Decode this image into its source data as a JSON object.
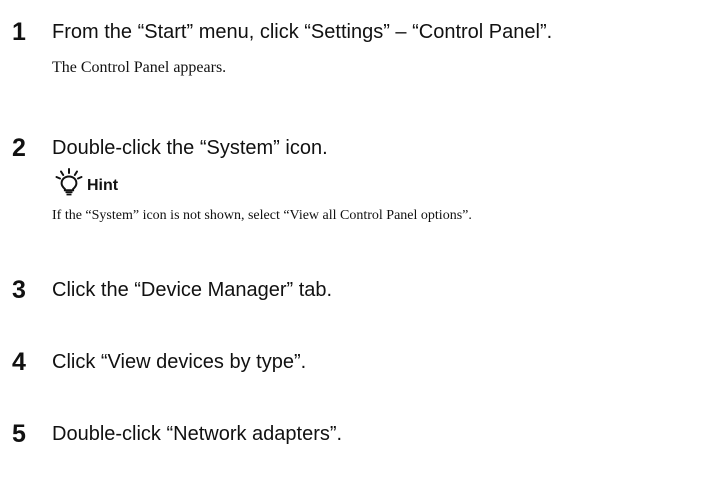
{
  "steps": [
    {
      "number": "1",
      "instruction": "From the “Start” menu, click “Settings” – “Control Panel”.",
      "result": "The Control Panel appears."
    },
    {
      "number": "2",
      "instruction": "Double-click the “System” icon.",
      "hint": {
        "label": "Hint",
        "icon": "lightbulb-icon",
        "text": "If the “System” icon is not shown, select “View all Control Panel options”."
      }
    },
    {
      "number": "3",
      "instruction": "Click the “Device Manager” tab."
    },
    {
      "number": "4",
      "instruction": "Click “View devices by type”."
    },
    {
      "number": "5",
      "instruction": "Double-click “Network adapters”."
    }
  ]
}
